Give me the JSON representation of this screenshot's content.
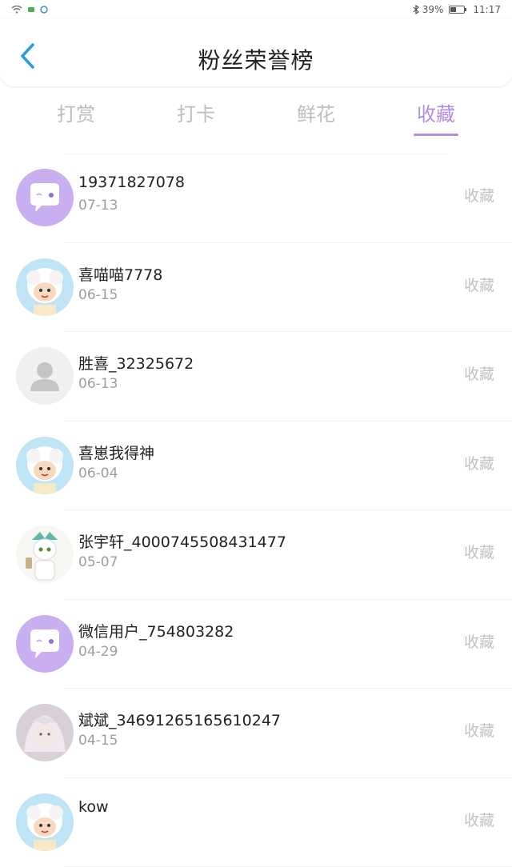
{
  "status_bar": {
    "battery": "39%",
    "battery_level": 0.39,
    "time": "11:17"
  },
  "header": {
    "title": "粉丝荣誉榜"
  },
  "tabs": [
    {
      "label": "打赏",
      "active": false
    },
    {
      "label": "打卡",
      "active": false
    },
    {
      "label": "鲜花",
      "active": false
    },
    {
      "label": "收藏",
      "active": true
    }
  ],
  "fans": [
    {
      "name": "19371827078",
      "date": "07-13",
      "action": "收藏",
      "avatar": "chat-bubble"
    },
    {
      "name": "喜喵喵7778",
      "date": "06-15",
      "action": "收藏",
      "avatar": "cartoon-sheep"
    },
    {
      "name": "胜喜_32325672",
      "date": "06-13",
      "action": "收藏",
      "avatar": "default-person"
    },
    {
      "name": "喜崽我得神",
      "date": "06-04",
      "action": "收藏",
      "avatar": "cartoon-sheep"
    },
    {
      "name": "张宇轩_4000745508431477",
      "date": "05-07",
      "action": "收藏",
      "avatar": "cartoon-character"
    },
    {
      "name": "微信用户_754803282",
      "date": "04-29",
      "action": "收藏",
      "avatar": "chat-bubble"
    },
    {
      "name": "斌斌_34691265165610247",
      "date": "04-15",
      "action": "收藏",
      "avatar": "anime-portrait"
    },
    {
      "name": "kow",
      "date": "",
      "action": "收藏",
      "avatar": "cartoon-sheep"
    }
  ],
  "colors": {
    "accent": "#b48be0",
    "avatar_purple": "#c9aef0"
  }
}
